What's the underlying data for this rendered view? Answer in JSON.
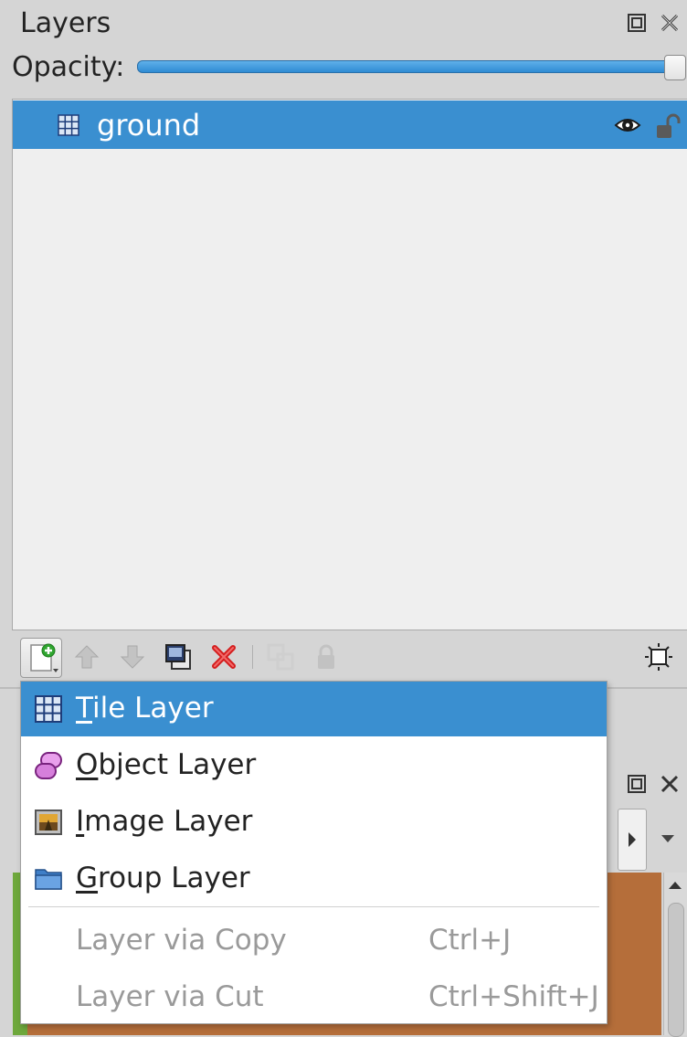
{
  "panel": {
    "title": "Layers",
    "opacity_label": "Opacity:",
    "opacity_value": 1.0,
    "float_icon": "float-window-icon",
    "close_icon": "close-icon"
  },
  "layers": [
    {
      "name": "ground",
      "type_icon": "tile-layer-icon",
      "visible_icon": "eye-icon",
      "lock_icon": "unlocked-icon",
      "selected": true
    }
  ],
  "toolbar": {
    "new_layer_icon": "new-layer-icon",
    "raise_icon": "arrow-up-icon",
    "lower_icon": "arrow-down-icon",
    "duplicate_icon": "duplicate-icon",
    "remove_icon": "remove-icon",
    "merge_icon": "merge-icon",
    "lock_icon": "lock-icon",
    "highlight_icon": "highlight-layer-icon"
  },
  "menu": {
    "items": [
      {
        "mnemonic": "T",
        "rest": "ile Layer",
        "icon": "tile-layer-icon",
        "active": true
      },
      {
        "mnemonic": "O",
        "rest": "bject Layer",
        "icon": "object-layer-icon"
      },
      {
        "mnemonic": "I",
        "rest": "mage Layer",
        "icon": "image-layer-icon"
      },
      {
        "mnemonic": "G",
        "rest": "roup Layer",
        "icon": "group-layer-icon"
      }
    ],
    "disabled_items": [
      {
        "label": "Layer via Copy",
        "shortcut": "Ctrl+J"
      },
      {
        "label": "Layer via Cut",
        "shortcut": "Ctrl+Shift+J"
      }
    ]
  },
  "colors": {
    "selection": "#3a8fd0",
    "slider": "#2f8bd3",
    "panel_bg": "#d5d5d5",
    "list_bg": "#efefef"
  }
}
